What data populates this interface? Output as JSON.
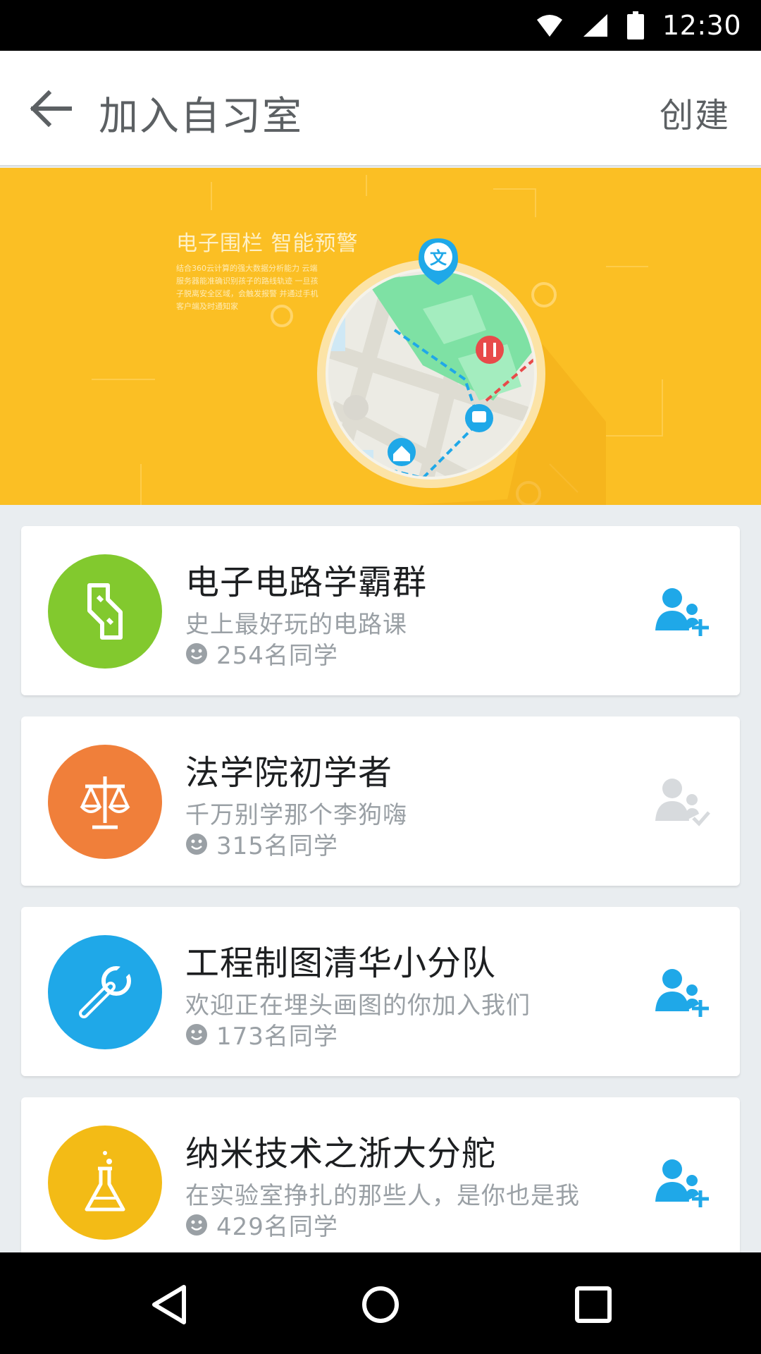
{
  "status_bar": {
    "time": "12:30",
    "icons": [
      "wifi-icon",
      "cell-signal-icon",
      "battery-icon"
    ]
  },
  "app_bar": {
    "back_icon": "arrow-left-icon",
    "title": "加入自习室",
    "action_label": "创建"
  },
  "banner": {
    "headline": "电子围栏 智能预警",
    "description": "结合360云计算的强大数据分析能力 云端服务器能准确识别孩子的路线轨迹 一旦孩子脱离安全区域，会触发报警 并通过手机客户端及时通知家",
    "map_icons": [
      "text-pin-icon",
      "restaurant-icon",
      "bus-icon",
      "home-icon",
      "shopping-cart-icon"
    ]
  },
  "rooms": [
    {
      "title": "电子电路学霸群",
      "description": "史上最好玩的电路课",
      "members": "254名同学",
      "icon": "circuit-icon",
      "color": "#82c92e",
      "action": "add-user-icon",
      "joined": false
    },
    {
      "title": "法学院初学者",
      "description": "千万别学那个李狗嗨",
      "members": "315名同学",
      "icon": "scales-icon",
      "color": "#f07f3a",
      "action": "user-check-icon",
      "joined": true
    },
    {
      "title": "工程制图清华小分队",
      "description": "欢迎正在埋头画图的你加入我们",
      "members": "173名同学",
      "icon": "wrench-icon",
      "color": "#1fa8e8",
      "action": "add-user-icon",
      "joined": false
    },
    {
      "title": "纳米技术之浙大分舵",
      "description": "在实验室挣扎的那些人，是你也是我",
      "members": "429名同学",
      "icon": "flask-icon",
      "color": "#f3bb16",
      "action": "add-user-icon",
      "joined": false
    }
  ],
  "colors": {
    "accent": "#1fa8e8",
    "banner_bg": "#fbbf24",
    "joined_icon": "#d7dadd"
  },
  "nav_bar": {
    "icons": [
      "back-triangle-icon",
      "home-circle-icon",
      "recents-square-icon"
    ]
  }
}
